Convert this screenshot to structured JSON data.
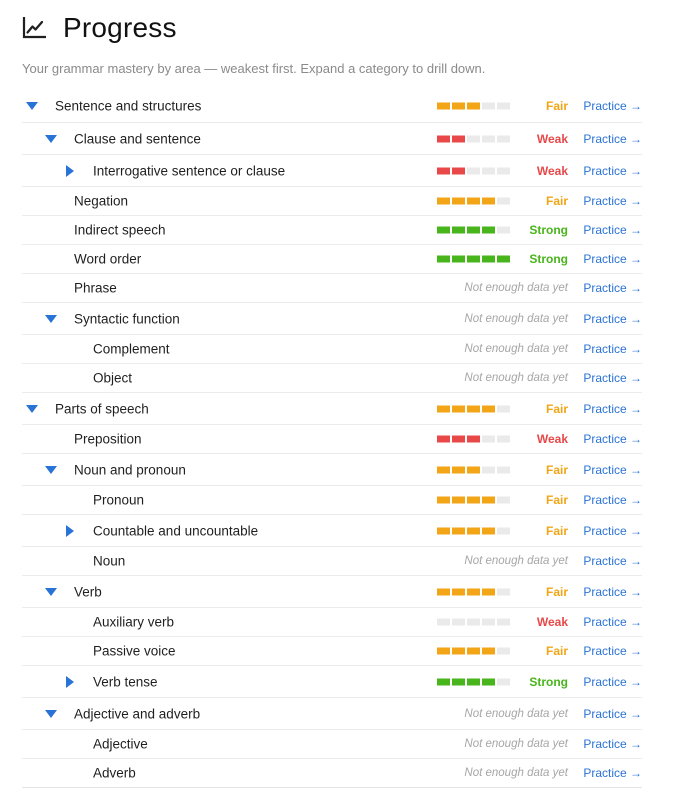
{
  "header": {
    "title": "Progress",
    "icon": "line-chart-icon",
    "subtitle": "Your grammar mastery by area — weakest first. Expand a category to drill down."
  },
  "colors": {
    "weak": "#e84848",
    "fair": "#f2a516",
    "strong": "#49b51c",
    "empty": "#eaeaea",
    "link": "#2a73d6",
    "caret": "#2a73d6"
  },
  "practice_label": "Practice →",
  "rows": [
    {
      "label": "Sentence and structures",
      "level": 0,
      "caret": "down",
      "status": "Fair",
      "filled": 3,
      "h": 34
    },
    {
      "label": "Clause and sentence",
      "level": 1,
      "caret": "down",
      "status": "Weak",
      "filled": 2,
      "h": 32
    },
    {
      "label": "Interrogative sentence or clause",
      "level": 2,
      "caret": "right",
      "status": "Weak",
      "filled": 2,
      "h": 32
    },
    {
      "label": "Negation",
      "level": 1,
      "caret": null,
      "status": "Fair",
      "filled": 4,
      "h": 29
    },
    {
      "label": "Indirect speech",
      "level": 1,
      "caret": null,
      "status": "Strong",
      "filled": 4,
      "h": 29
    },
    {
      "label": "Word order",
      "level": 1,
      "caret": null,
      "status": "Strong",
      "filled": 5,
      "h": 29
    },
    {
      "label": "Phrase",
      "level": 1,
      "caret": null,
      "status": "Not enough data yet",
      "filled": null,
      "h": 29
    },
    {
      "label": "Syntactic function",
      "level": 1,
      "caret": "down",
      "status": "Not enough data yet",
      "filled": null,
      "h": 32
    },
    {
      "label": "Complement",
      "level": 2,
      "caret": null,
      "status": "Not enough data yet",
      "filled": null,
      "h": 29
    },
    {
      "label": "Object",
      "level": 2,
      "caret": null,
      "status": "Not enough data yet",
      "filled": null,
      "h": 29
    },
    {
      "label": "Parts of speech",
      "level": 0,
      "caret": "down",
      "status": "Fair",
      "filled": 4,
      "h": 32
    },
    {
      "label": "Preposition",
      "level": 1,
      "caret": null,
      "status": "Weak",
      "filled": 3,
      "h": 29
    },
    {
      "label": "Noun and pronoun",
      "level": 1,
      "caret": "down",
      "status": "Fair",
      "filled": 3,
      "h": 32
    },
    {
      "label": "Pronoun",
      "level": 2,
      "caret": null,
      "status": "Fair",
      "filled": 4,
      "h": 29
    },
    {
      "label": "Countable and uncountable",
      "level": 2,
      "caret": "right",
      "status": "Fair",
      "filled": 4,
      "h": 32
    },
    {
      "label": "Noun",
      "level": 2,
      "caret": null,
      "status": "Not enough data yet",
      "filled": null,
      "h": 29
    },
    {
      "label": "Verb",
      "level": 1,
      "caret": "down",
      "status": "Fair",
      "filled": 4,
      "h": 32
    },
    {
      "label": "Auxiliary verb",
      "level": 2,
      "caret": null,
      "status": "Weak",
      "filled": 0,
      "h": 29
    },
    {
      "label": "Passive voice",
      "level": 2,
      "caret": null,
      "status": "Fair",
      "filled": 4,
      "h": 29
    },
    {
      "label": "Verb tense",
      "level": 2,
      "caret": "right",
      "status": "Strong",
      "filled": 4,
      "h": 32
    },
    {
      "label": "Adjective and adverb",
      "level": 1,
      "caret": "down",
      "status": "Not enough data yet",
      "filled": null,
      "h": 32
    },
    {
      "label": "Adjective",
      "level": 2,
      "caret": null,
      "status": "Not enough data yet",
      "filled": null,
      "h": 29
    },
    {
      "label": "Adverb",
      "level": 2,
      "caret": null,
      "status": "Not enough data yet",
      "filled": null,
      "h": 29
    }
  ]
}
